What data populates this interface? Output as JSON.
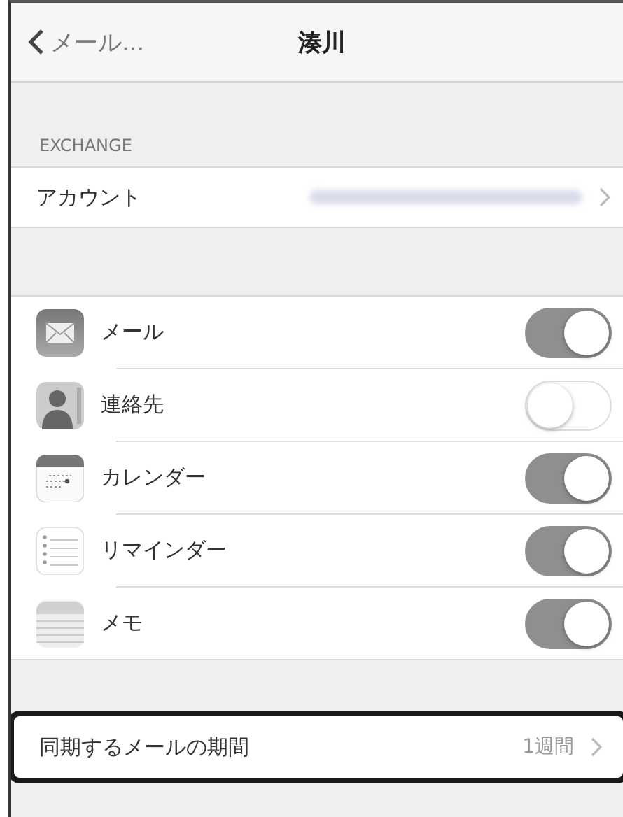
{
  "nav": {
    "back": "メール...",
    "title": "湊川"
  },
  "section_header": "EXCHANGE",
  "account": {
    "label": "アカウント",
    "value_blurred": true
  },
  "services": [
    {
      "kind": "mail",
      "label": "メール",
      "on": true
    },
    {
      "kind": "contacts",
      "label": "連絡先",
      "on": false
    },
    {
      "kind": "calendar",
      "label": "カレンダー",
      "on": true
    },
    {
      "kind": "reminders",
      "label": "リマインダー",
      "on": true
    },
    {
      "kind": "notes",
      "label": "メモ",
      "on": true
    }
  ],
  "sync": {
    "label": "同期するメールの期間",
    "value": "1週間",
    "highlighted": true
  }
}
